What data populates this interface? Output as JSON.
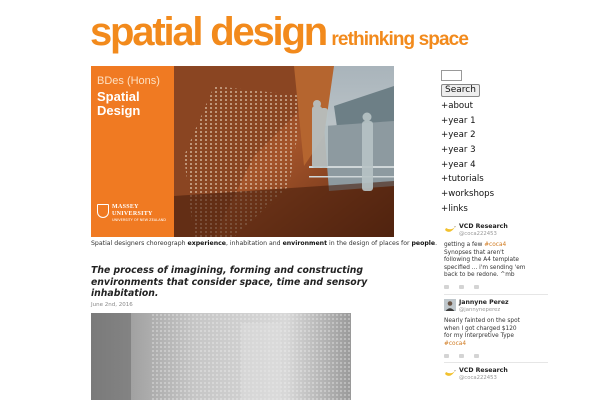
{
  "site": {
    "title": "spatial design",
    "subtitle": "rethinking space"
  },
  "hero": {
    "line1": "BDes (Hons)",
    "line2": "Spatial",
    "line3": "Design",
    "logo_name": "MASSEY",
    "logo_name2": "UNIVERSITY",
    "logo_sub": "UNIVERSITY OF NEW ZEALAND"
  },
  "caption": {
    "part1": "Spatial designers choreograph ",
    "bold1": "experience",
    "part2": ", inhabitation and ",
    "bold2": "environment",
    "part3": " in the design of places for ",
    "bold3": "people",
    "part4": "."
  },
  "lead": "The process of imagining, forming and constructing environments that consider space, time and sensory inhabitation.",
  "post": {
    "date": "June 2nd, 2016"
  },
  "sidebar": {
    "search_button": "Search",
    "nav": [
      "+about",
      "+year 1",
      "+year 2",
      "+year 3",
      "+year 4",
      "+tutorials",
      "+workshops",
      "+links"
    ]
  },
  "feed": [
    {
      "name": "VCD Research",
      "handle": "@coca222453",
      "lines": [
        {
          "pre": "getting a few ",
          "tag": "#coca4",
          "post": ""
        },
        {
          "pre": "Synopses that aren't",
          "tag": "",
          "post": ""
        },
        {
          "pre": "following the A4 template",
          "tag": "",
          "post": ""
        },
        {
          "pre": "specified ... i'm sending 'em",
          "tag": "",
          "post": ""
        },
        {
          "pre": "back to be redone. ^mb",
          "tag": "",
          "post": ""
        }
      ]
    },
    {
      "name": "Jannyne Perez",
      "handle": "@jannyneperez",
      "lines": [
        {
          "pre": "Nearly fainted on the spot",
          "tag": "",
          "post": ""
        },
        {
          "pre": "when I got charged $120",
          "tag": "",
          "post": ""
        },
        {
          "pre": "for my Interpretive Type",
          "tag": "",
          "post": ""
        },
        {
          "pre": "",
          "tag": "#coca4",
          "post": ""
        }
      ]
    },
    {
      "name": "VCD Research",
      "handle": "@coca222453",
      "lines": []
    }
  ],
  "colors": {
    "brand_orange": "#f28a1c",
    "panel_orange": "#f07a22",
    "hashtag": "#d07a20"
  },
  "icons": {
    "avatar_vcd": "banana-avatar-icon",
    "avatar_jannyne": "person-avatar-icon"
  }
}
